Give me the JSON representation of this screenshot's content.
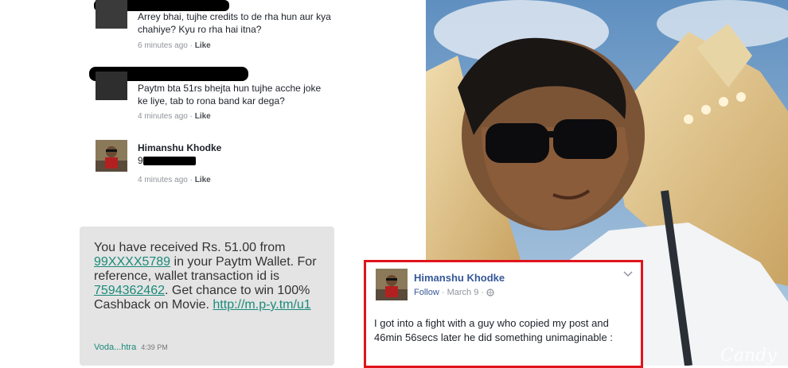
{
  "comments": [
    {
      "text": "Arrey bhai, tujhe credits to de rha hun aur kya chahiye? Kyu ro rha hai itna?",
      "time": "6 minutes ago",
      "like": "Like"
    },
    {
      "text": "Paytm bta 51rs bhejta hun tujhe acche joke ke liye, tab to rona band kar dega?",
      "time": "4 minutes ago",
      "like": "Like"
    },
    {
      "name": "Himanshu Khodke",
      "text": "9",
      "time": "4 minutes ago",
      "like": "Like"
    }
  ],
  "meta_separator": "·",
  "sms": {
    "line1": "You have received Rs. 51.00 from",
    "phone": "99XXXX5789",
    "line2": " in your Paytm Wallet. For reference, wallet transaction id is ",
    "txn_id": "7594362462",
    "line3": ". Get chance to win 100% Cashback on Movie. ",
    "url": "http://m.p-y.tm/u1",
    "sender": "Voda...htra",
    "time": "4:39 PM"
  },
  "fb_post": {
    "name": "Himanshu Khodke",
    "follow": "Follow",
    "date": "March 9",
    "body": "I got into a fight with a guy who copied my post and 46min 56secs later he did something unimaginable :"
  },
  "colors": {
    "fb_blue": "#365899",
    "red_border": "#e0141b",
    "sms_bg": "#e4e4e4",
    "sms_link": "#1a8a7a"
  },
  "photo_watermark": "Candy"
}
